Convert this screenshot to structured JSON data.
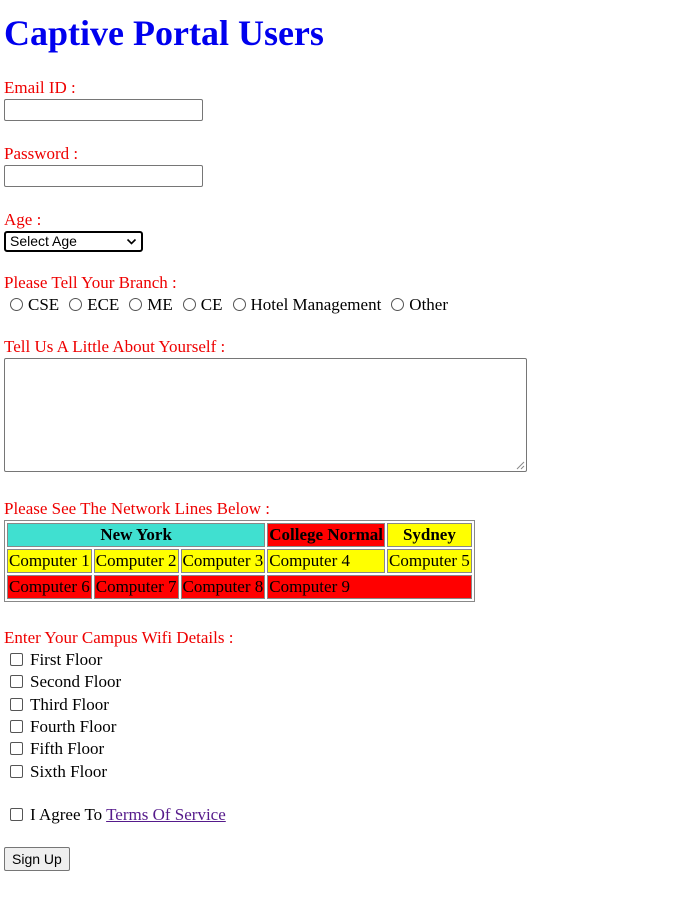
{
  "page_title": "Captive Portal Users",
  "form": {
    "email_label": "Email ID :",
    "email_value": "",
    "password_label": "Password :",
    "password_value": "",
    "age_label": "Age :",
    "age_selected": "Select Age",
    "branch_label": "Please Tell Your Branch :",
    "branch_options": [
      "CSE",
      "ECE",
      "ME",
      "CE",
      "Hotel Management",
      "Other"
    ],
    "about_label": "Tell Us A Little About Yourself :",
    "about_value": "",
    "network_label": "Please See The Network Lines Below :",
    "network_table": {
      "headers": [
        {
          "text": "New York",
          "colspan": 3,
          "bg": "#40e0d0"
        },
        {
          "text": "College Normal",
          "colspan": 1,
          "bg": "#ff0000"
        },
        {
          "text": "Sydney",
          "colspan": 1,
          "bg": "#ffff00"
        }
      ],
      "rows": [
        [
          {
            "text": "Computer 1",
            "bg": "#ffff00",
            "colspan": 1
          },
          {
            "text": "Computer 2",
            "bg": "#ffff00",
            "colspan": 1
          },
          {
            "text": "Computer 3",
            "bg": "#ffff00",
            "colspan": 1
          },
          {
            "text": "Computer 4",
            "bg": "#ffff00",
            "colspan": 1
          },
          {
            "text": "Computer 5",
            "bg": "#ffff00",
            "colspan": 1
          }
        ],
        [
          {
            "text": "Computer 6",
            "bg": "#ff0000",
            "colspan": 1
          },
          {
            "text": "Computer 7",
            "bg": "#ff0000",
            "colspan": 1
          },
          {
            "text": "Computer 8",
            "bg": "#ff0000",
            "colspan": 1
          },
          {
            "text": "Computer 9",
            "bg": "#ff0000",
            "colspan": 2
          }
        ]
      ]
    },
    "wifi_label": "Enter Your Campus Wifi Details :",
    "wifi_options": [
      "First Floor",
      "Second Floor",
      "Third Floor",
      "Fourth Floor",
      "Fifth Floor",
      "Sixth Floor"
    ],
    "agree_prefix": "I Agree To",
    "agree_link": "Terms Of Service",
    "submit_label": "Sign Up"
  },
  "colors": {
    "title": "#0000ee",
    "label": "#ee0000",
    "link_visited": "#551a8b"
  }
}
